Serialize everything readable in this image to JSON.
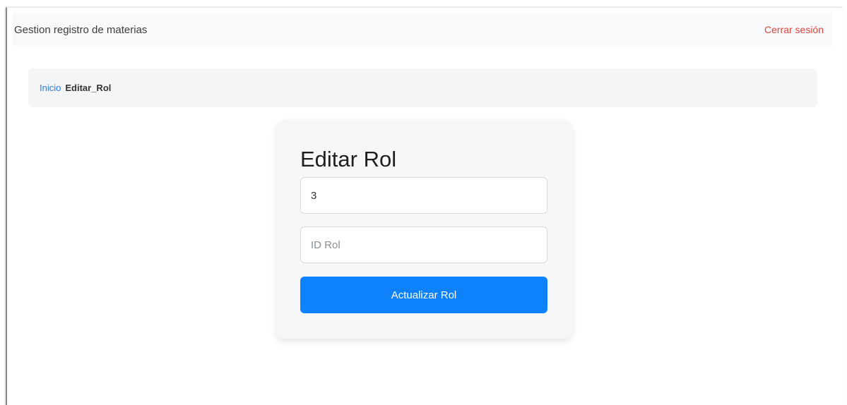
{
  "navbar": {
    "brand": "Gestion registro de materias",
    "logout_label": "Cerrar sesión"
  },
  "breadcrumb": {
    "home_label": "Inicio",
    "current_label": "Editar_Rol"
  },
  "form": {
    "title": "Editar Rol",
    "field_1": {
      "value": "3",
      "placeholder": ""
    },
    "field_2": {
      "value": "",
      "placeholder": "ID Rol"
    },
    "submit_label": "Actualizar Rol"
  },
  "colors": {
    "accent": "#0d82fb",
    "link": "#1e7cf2",
    "logout": "#e0433a"
  }
}
